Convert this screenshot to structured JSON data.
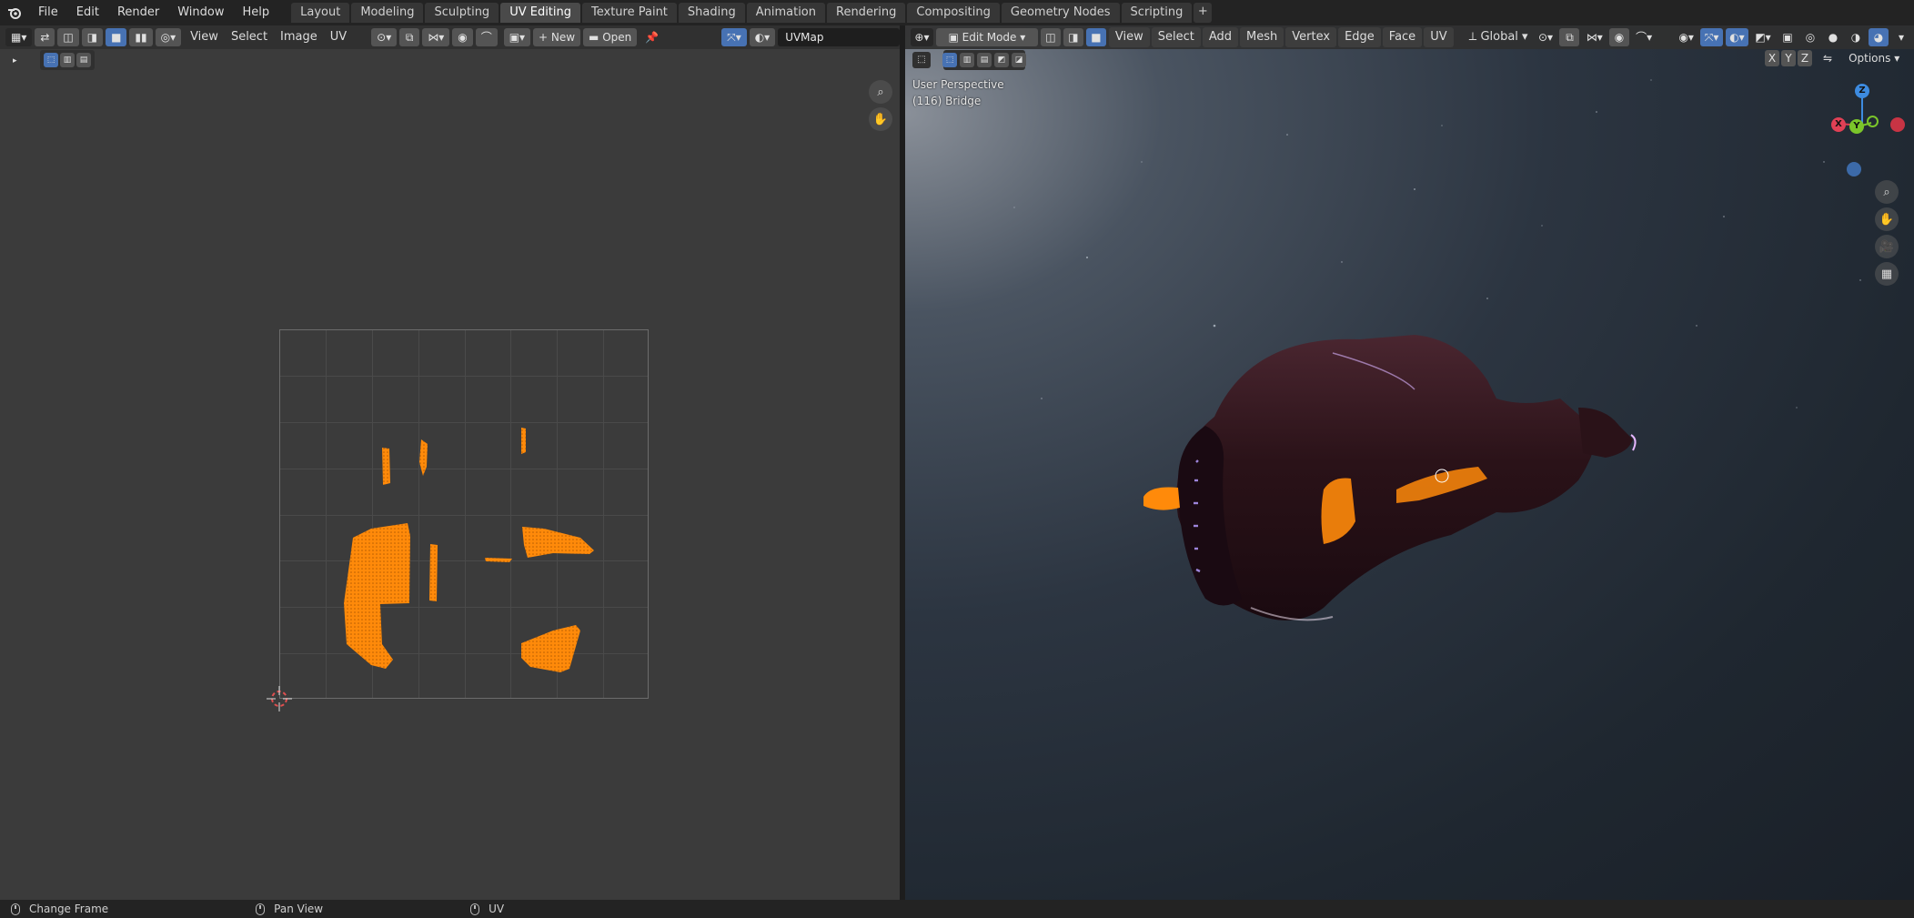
{
  "topbar": {
    "menus": [
      "File",
      "Edit",
      "Render",
      "Window",
      "Help"
    ],
    "workspaces": [
      "Layout",
      "Modeling",
      "Sculpting",
      "UV Editing",
      "Texture Paint",
      "Shading",
      "Animation",
      "Rendering",
      "Compositing",
      "Geometry Nodes",
      "Scripting"
    ],
    "active_workspace": "UV Editing",
    "add_tab": "+"
  },
  "uv_editor": {
    "menus": [
      "View",
      "Select",
      "Image",
      "UV"
    ],
    "new_label": "New",
    "open_label": "Open",
    "uvmap_value": "UVMap"
  },
  "viewport": {
    "mode_label": "Edit Mode",
    "menus": [
      "View",
      "Select",
      "Add",
      "Mesh",
      "Vertex",
      "Edge",
      "Face",
      "UV"
    ],
    "transform_orientation": "Global",
    "options_label": "Options",
    "axis_lock": [
      "X",
      "Y",
      "Z"
    ],
    "overlay_line1": "User Perspective",
    "overlay_line2": "(116) Bridge",
    "gizmo": {
      "x": "X",
      "y": "Y",
      "z": "Z"
    }
  },
  "statusbar": {
    "items": [
      "Change Frame",
      "Pan View",
      "UV"
    ]
  },
  "colors": {
    "uv_selected": "#ff8a0a",
    "accent_blue": "#4772b3",
    "axis_x": "#e04055",
    "axis_y": "#7bc52a",
    "axis_z": "#3d8be0"
  }
}
